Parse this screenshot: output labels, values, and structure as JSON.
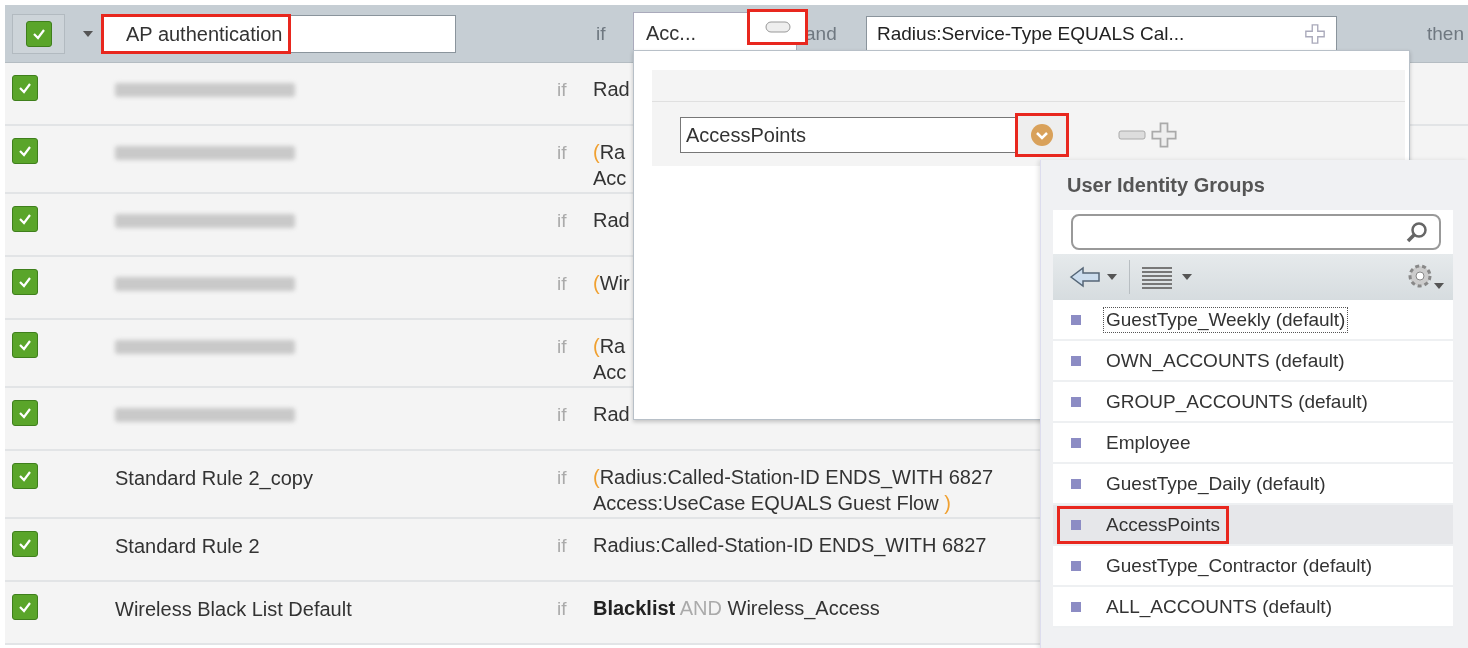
{
  "header_rule": {
    "enabled": true,
    "name": "AP authentication",
    "name_highlighted": true,
    "if_label": "if",
    "and_label": "and",
    "condition": "Radius:Service-Type EQUALS Cal...",
    "then_label": "then"
  },
  "rules": [
    {
      "enabled": true,
      "redacted": true,
      "if_label": "if",
      "condition": [
        [
          {
            "kind": "plain",
            "text": "Rad"
          }
        ]
      ]
    },
    {
      "enabled": true,
      "redacted": true,
      "if_label": "if",
      "condition": [
        [
          {
            "kind": "paren",
            "text": "("
          },
          {
            "kind": "plain",
            "text": "Ra"
          }
        ],
        [
          {
            "kind": "plain",
            "text": "Acc"
          }
        ]
      ]
    },
    {
      "enabled": true,
      "redacted": true,
      "if_label": "if",
      "condition": [
        [
          {
            "kind": "plain",
            "text": "Rad"
          }
        ]
      ]
    },
    {
      "enabled": true,
      "redacted": true,
      "if_label": "if",
      "condition": [
        [
          {
            "kind": "paren",
            "text": "("
          },
          {
            "kind": "plain",
            "text": "Wir"
          }
        ]
      ]
    },
    {
      "enabled": true,
      "redacted": true,
      "if_label": "if",
      "condition": [
        [
          {
            "kind": "paren",
            "text": "("
          },
          {
            "kind": "plain",
            "text": "Ra"
          }
        ],
        [
          {
            "kind": "plain",
            "text": "Acc"
          }
        ]
      ]
    },
    {
      "enabled": true,
      "redacted": true,
      "if_label": "if",
      "condition": [
        [
          {
            "kind": "plain",
            "text": "Rad"
          }
        ]
      ]
    },
    {
      "enabled": true,
      "redacted": false,
      "name": "Standard Rule 2_copy",
      "if_label": "if",
      "condition": [
        [
          {
            "kind": "paren",
            "text": "("
          },
          {
            "kind": "plain",
            "text": "Radius:Called-Station-ID ENDS_WITH 6827"
          }
        ],
        [
          {
            "kind": "plain",
            "text": "Access:UseCase EQUALS Guest Flow "
          },
          {
            "kind": "paren",
            "text": ")"
          }
        ]
      ]
    },
    {
      "enabled": true,
      "redacted": false,
      "name": "Standard Rule 2",
      "if_label": "if",
      "condition": [
        [
          {
            "kind": "plain",
            "text": "Radius:Called-Station-ID ENDS_WITH 6827"
          }
        ]
      ]
    },
    {
      "enabled": true,
      "redacted": false,
      "name": "Wireless Black List Default",
      "if_label": "if",
      "condition": [
        [
          {
            "kind": "bold",
            "text": "Blacklist"
          },
          {
            "kind": "op",
            "text": " AND "
          },
          {
            "kind": "plain",
            "text": "Wireless_Access"
          }
        ]
      ]
    }
  ],
  "condition_popup": {
    "tab_label": "Acc...",
    "remove_highlighted": true,
    "select": {
      "value": "AccessPoints",
      "button_highlighted": true
    }
  },
  "identity_groups": {
    "title": "User Identity Groups",
    "items": [
      {
        "label": "GuestType_Weekly (default)",
        "selected": false,
        "focused": true,
        "highlighted": false
      },
      {
        "label": "OWN_ACCOUNTS (default)",
        "selected": false,
        "focused": false,
        "highlighted": false
      },
      {
        "label": "GROUP_ACCOUNTS (default)",
        "selected": false,
        "focused": false,
        "highlighted": false
      },
      {
        "label": "Employee",
        "selected": false,
        "focused": false,
        "highlighted": false
      },
      {
        "label": "GuestType_Daily (default)",
        "selected": false,
        "focused": false,
        "highlighted": false
      },
      {
        "label": "AccessPoints",
        "selected": true,
        "focused": false,
        "highlighted": true
      },
      {
        "label": "GuestType_Contractor (default)",
        "selected": false,
        "focused": false,
        "highlighted": false
      },
      {
        "label": "ALL_ACCOUNTS (default)",
        "selected": false,
        "focused": false,
        "highlighted": false
      }
    ]
  }
}
